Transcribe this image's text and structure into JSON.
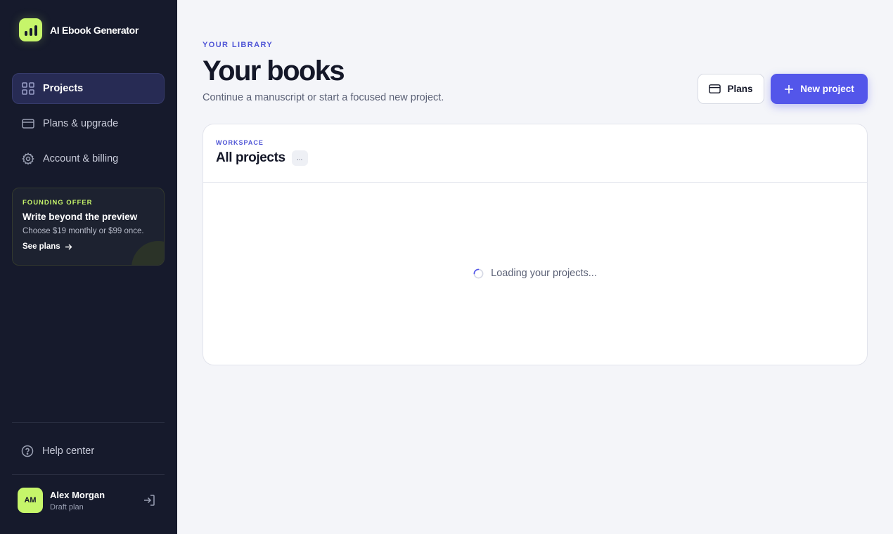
{
  "sidebar": {
    "brand": "AI Ebook Generator",
    "nav": [
      {
        "label": "Projects",
        "icon": "grid-icon",
        "active": true
      },
      {
        "label": "Plans & upgrade",
        "icon": "credit-card-icon",
        "active": false
      },
      {
        "label": "Account & billing",
        "icon": "gear-icon",
        "active": false
      }
    ],
    "offer": {
      "kicker": "FOUNDING OFFER",
      "title": "Write beyond the preview",
      "text": "Choose $19 monthly or $99 once.",
      "link": "See plans"
    },
    "help": "Help center",
    "user": {
      "initials": "AM",
      "name": "Alex Morgan",
      "plan": "Draft plan"
    }
  },
  "header": {
    "kicker": "YOUR LIBRARY",
    "title": "Your books",
    "subtitle": "Continue a manuscript or start a focused new project.",
    "plans_button": "Plans",
    "new_button": "New project"
  },
  "panel": {
    "kicker": "WORKSPACE",
    "title": "All projects",
    "count": "...",
    "loading": "Loading your projects..."
  },
  "colors": {
    "sidebar_bg": "#161a2c",
    "accent": "#5356ea",
    "lime": "#c6f56a",
    "page_bg": "#f4f5f9"
  }
}
